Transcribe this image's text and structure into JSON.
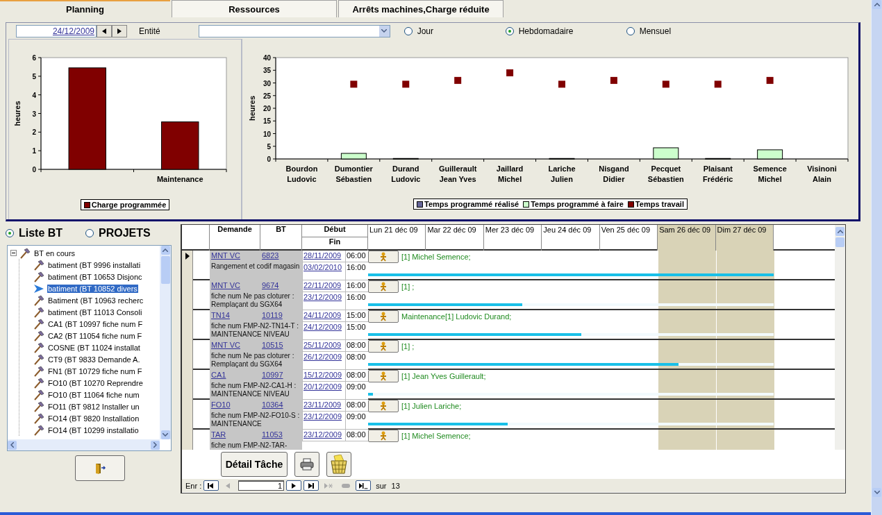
{
  "tabs": [
    {
      "label": "Planning",
      "selected": true
    },
    {
      "label": "Ressources",
      "selected": false
    },
    {
      "label": "Arrêts machines,Charge réduite",
      "selected": false
    }
  ],
  "filter": {
    "date": "24/12/2009",
    "entity_label": "Entité",
    "periods": [
      {
        "label": "Jour",
        "selected": false
      },
      {
        "label": "Hebdomadaire",
        "selected": true
      },
      {
        "label": "Mensuel",
        "selected": false
      }
    ]
  },
  "load_chart": {
    "chart_data": {
      "type": "bar",
      "ylabel": "heures",
      "categories": [
        null,
        "Maintenance"
      ],
      "series": [
        {
          "name": "Charge programmée",
          "color": "#800000",
          "values": [
            5.45,
            2.55
          ]
        }
      ],
      "legend": true,
      "ylim": [
        0,
        6
      ],
      "yticks": [
        0,
        1,
        2,
        3,
        4,
        5,
        6
      ]
    }
  },
  "staff_chart": {
    "chart_data": {
      "type": "bar",
      "ylabel": "heures",
      "stacked": true,
      "categories": [
        "Bourdon Ludovic",
        "Dumontier Sébastien",
        "Durand Ludovic",
        "Guillerault Jean Yves",
        "Jaillard Michel",
        "Lariche Julien",
        "Nisgand Didier",
        "Pecquet Sébastien",
        "Plaisant Frédéric",
        "Semence Michel",
        "Visinoni Alain"
      ],
      "series": [
        {
          "name": "Temps programmé réalisé",
          "color": "#666699",
          "values": [
            0,
            0,
            0,
            0,
            0,
            0,
            0,
            0,
            0,
            0,
            0
          ]
        },
        {
          "name": "Temps programmé à faire",
          "color": "#ccffcc",
          "values": [
            0,
            2.2,
            0.2,
            0,
            0,
            0.2,
            0,
            4.4,
            0.2,
            3.6,
            0
          ]
        },
        {
          "name": "Temps travail",
          "color": "#800000",
          "type": "scatter",
          "values": [
            null,
            29.5,
            29.5,
            31,
            34,
            29.5,
            31,
            29.5,
            29.5,
            31,
            null
          ]
        }
      ],
      "legend": true,
      "ylim": [
        0,
        40
      ],
      "yticks": [
        0,
        5,
        10,
        15,
        20,
        25,
        30,
        35,
        40
      ]
    }
  },
  "list_modes": [
    {
      "label": "Liste BT",
      "selected": true
    },
    {
      "label": "PROJETS",
      "selected": false
    }
  ],
  "tree": [
    {
      "label": "BT en cours",
      "expanded": true,
      "selected": false,
      "children": [
        {
          "label": "batiment (BT 9996 installati",
          "selected": false
        },
        {
          "label": "batiment (BT 10653 Disjonc",
          "selected": false
        },
        {
          "label": "batiment (BT 10852 divers",
          "selected": true
        },
        {
          "label": "Batiment (BT 10963 recherc",
          "selected": false
        },
        {
          "label": "batiment (BT 11013 Consoli",
          "selected": false
        },
        {
          "label": "CA1 (BT 10997 fiche num F",
          "selected": false
        },
        {
          "label": "CA2 (BT 11054 fiche num F",
          "selected": false
        },
        {
          "label": "COSNE (BT 11024 installat",
          "selected": false
        },
        {
          "label": "CT9 (BT 9833 Demande A.",
          "selected": false
        },
        {
          "label": "FN1 (BT 10729 fiche num F",
          "selected": false
        },
        {
          "label": "FO10 (BT 10270 Reprendre",
          "selected": false
        },
        {
          "label": "FO10 (BT 11064 fiche num",
          "selected": false
        },
        {
          "label": "FO11 (BT 9812 Installer un",
          "selected": false
        },
        {
          "label": "FO14 (BT 9820 Installation",
          "selected": false
        },
        {
          "label": "FO14 (BT 10299 installatio",
          "selected": false
        }
      ]
    }
  ],
  "grid": {
    "columns": {
      "request": "Demande",
      "order": "BT",
      "start": "Début",
      "end": "Fin"
    },
    "days": [
      {
        "label": "Lun 21 déc 09",
        "weekend": false
      },
      {
        "label": "Mar 22 déc 09",
        "weekend": false
      },
      {
        "label": "Mer 23 déc 09",
        "weekend": false
      },
      {
        "label": "Jeu 24 déc 09",
        "weekend": false
      },
      {
        "label": "Ven 25 déc 09",
        "weekend": false
      },
      {
        "label": "Sam 26 déc 09",
        "weekend": true
      },
      {
        "label": "Dim 27 déc 09",
        "weekend": true
      }
    ],
    "rows": [
      {
        "request": "MNT VC",
        "order": "6823",
        "start_date": "28/11/2009",
        "start_time": "06:00",
        "end_date": "03/02/2010",
        "end_time": "16:00",
        "description": "Rangement et codif magasin",
        "assignment": "[1] Michel Semence;",
        "level": 1,
        "selected": true
      },
      {
        "request": "MNT VC",
        "order": "9674",
        "start_date": "22/11/2009",
        "start_time": "16:00",
        "end_date": "23/12/2009",
        "end_time": "16:00",
        "description": "fiche num Ne pas cloturer : Remplaçant du SGX64",
        "assignment": "[1] ;",
        "level": 0.38,
        "selected": false
      },
      {
        "request": "TN14",
        "order": "10119",
        "start_date": "24/11/2009",
        "start_time": "15:00",
        "end_date": "24/12/2009",
        "end_time": "15:00",
        "description": "fiche num FMP-N2-TN14-T : MAINTENANCE NIVEAU",
        "assignment": "Maintenance[1] Ludovic Durand;",
        "level": 0.525,
        "selected": false
      },
      {
        "request": "MNT VC",
        "order": "10515",
        "start_date": "25/11/2009",
        "start_time": "08:00",
        "end_date": "26/12/2009",
        "end_time": "08:00",
        "description": "fiche num Ne pas cloturer : Remplaçant du SGX64",
        "assignment": "[1] ;",
        "level": 0.765,
        "selected": false
      },
      {
        "request": "CA1",
        "order": "10997",
        "start_date": "15/12/2009",
        "start_time": "08:00",
        "end_date": "20/12/2009",
        "end_time": "09:00",
        "description": "fiche num FMP-N2-CA1-H : MAINTENANCE NIVEAU",
        "assignment": "[1] Jean Yves Guillerault;",
        "level": 0.012,
        "selected": false
      },
      {
        "request": "FO10",
        "order": "10364",
        "start_date": "23/11/2009",
        "start_time": "08:00",
        "end_date": "23/12/2009",
        "end_time": "09:00",
        "description": "fiche num FMP-N2-FO10-S : MAINTENANCE",
        "assignment": "[1] Julien Lariche;",
        "level": 0.345,
        "selected": false
      },
      {
        "request": "TAR",
        "order": "11053",
        "start_date": "23/12/2009",
        "start_time": "08:00",
        "description": "fiche num FMP-N2-TAR-",
        "assignment": "[1] Michel Semence;",
        "selected": false
      }
    ]
  },
  "actions": [
    {
      "kind": "text",
      "label": "Détail Tâche"
    },
    {
      "kind": "print"
    },
    {
      "kind": "delete"
    }
  ],
  "navigator": {
    "label": "Enr :",
    "current": "1",
    "of": "sur",
    "total": "13",
    "buttons": [
      {
        "kind": "first",
        "disabled": false
      },
      {
        "kind": "prev",
        "disabled": true
      },
      {
        "kind": "input"
      },
      {
        "kind": "next",
        "disabled": false
      },
      {
        "kind": "last",
        "disabled": false
      },
      {
        "kind": "new",
        "disabled": true
      },
      {
        "kind": "delete",
        "disabled": true
      },
      {
        "kind": "end",
        "disabled": false
      }
    ]
  }
}
